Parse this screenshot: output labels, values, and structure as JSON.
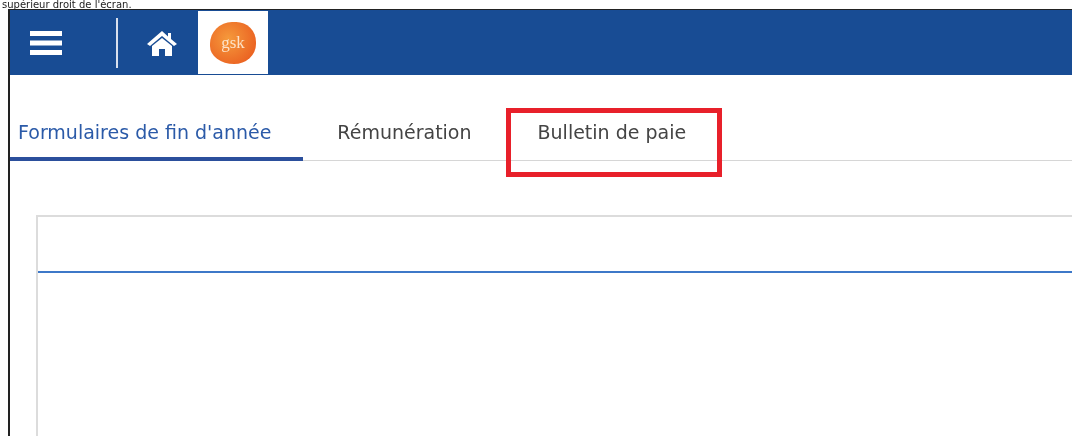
{
  "caption": "supérieur droit de l'écran.",
  "header": {
    "logo_text": "gsk"
  },
  "tabs": [
    {
      "label": "Formulaires de fin d'année",
      "selected": true,
      "highlighted": false
    },
    {
      "label": "Rémunération",
      "selected": false,
      "highlighted": false
    },
    {
      "label": "Bulletin de paie",
      "selected": false,
      "highlighted": true
    }
  ]
}
